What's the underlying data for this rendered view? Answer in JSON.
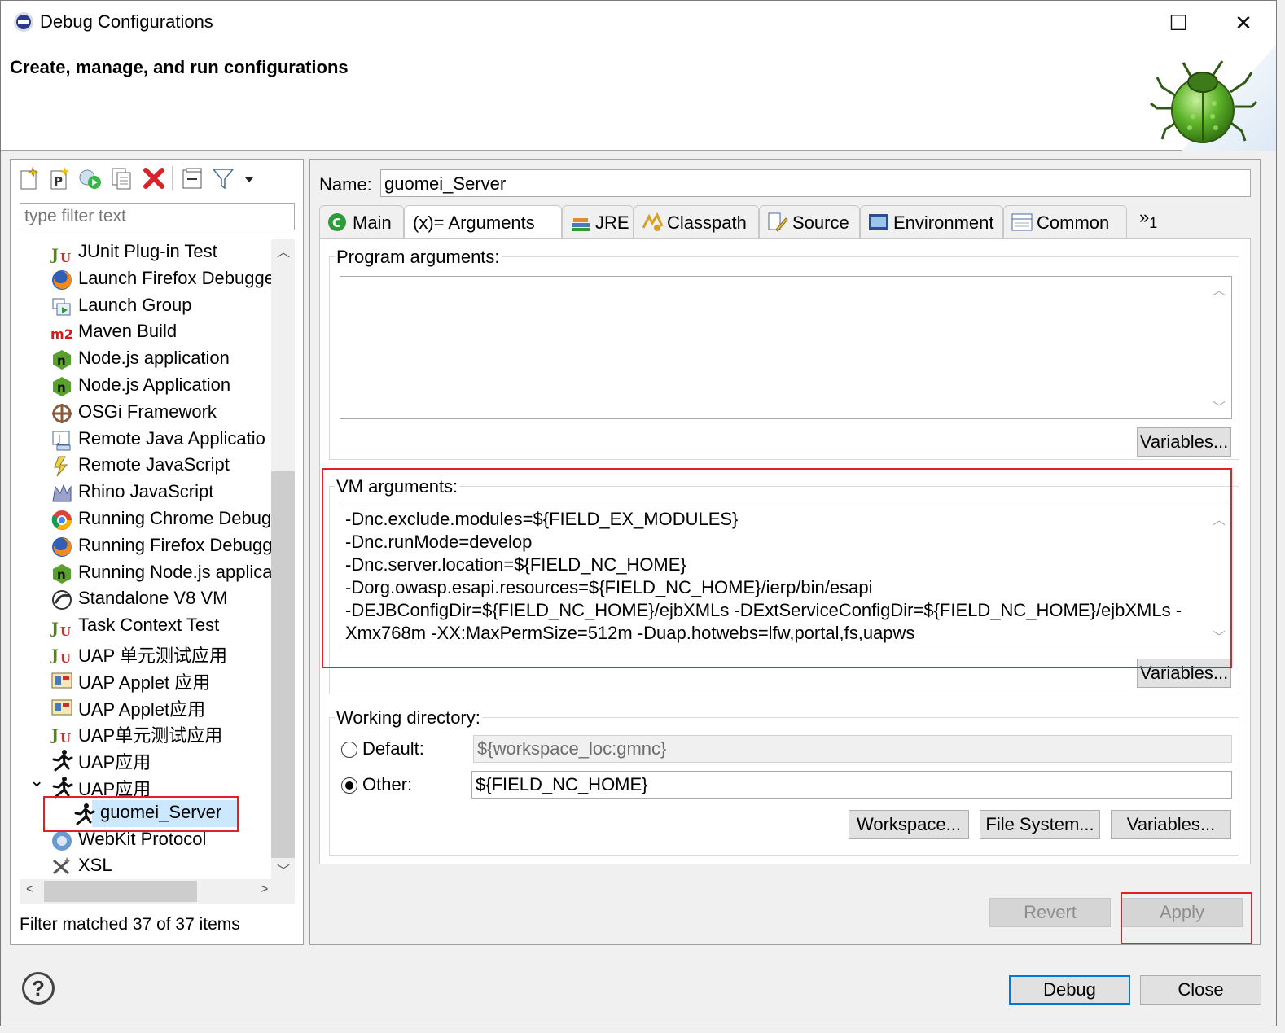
{
  "window": {
    "title": "Debug Configurations",
    "banner_title": "Create, manage, and run configurations",
    "maximize_glyph": "☐",
    "close_glyph": "✕"
  },
  "left": {
    "filter_placeholder": "type filter text",
    "items": [
      {
        "label": "JUnit Plug-in Test",
        "icon": "junit-plugin-icon"
      },
      {
        "label": "Launch Firefox Debugge",
        "icon": "firefox-icon"
      },
      {
        "label": "Launch Group",
        "icon": "launch-group-icon"
      },
      {
        "label": "Maven Build",
        "icon": "maven-icon"
      },
      {
        "label": "Node.js application",
        "icon": "nodejs-icon"
      },
      {
        "label": "Node.js Application",
        "icon": "nodejs-icon"
      },
      {
        "label": "OSGi Framework",
        "icon": "osgi-icon"
      },
      {
        "label": "Remote Java Applicatio",
        "icon": "remote-java-icon"
      },
      {
        "label": "Remote JavaScript",
        "icon": "remote-javascript-icon"
      },
      {
        "label": "Rhino JavaScript",
        "icon": "rhino-icon"
      },
      {
        "label": "Running Chrome Debug",
        "icon": "chrome-icon"
      },
      {
        "label": "Running Firefox Debugg",
        "icon": "firefox-icon"
      },
      {
        "label": "Running Node.js applica",
        "icon": "nodejs-icon"
      },
      {
        "label": "Standalone V8 VM",
        "icon": "v8-icon"
      },
      {
        "label": "Task Context Test",
        "icon": "task-context-icon"
      },
      {
        "label": "UAP 单元测试应用",
        "icon": "junit-icon"
      },
      {
        "label": "UAP Applet 应用",
        "icon": "applet-icon"
      },
      {
        "label": "UAP Applet应用",
        "icon": "applet-icon"
      },
      {
        "label": "UAP单元测试应用",
        "icon": "junit-icon"
      },
      {
        "label": "UAP应用",
        "icon": "runner-icon"
      },
      {
        "label": "UAP应用",
        "icon": "runner-icon",
        "expanded": true
      },
      {
        "label": "guomei_Server",
        "icon": "runner-icon",
        "child": true,
        "selected": true
      },
      {
        "label": "WebKit Protocol",
        "icon": "webkit-icon"
      },
      {
        "label": "XSL",
        "icon": "xsl-icon"
      }
    ],
    "status": "Filter matched 37 of 37 items",
    "expander_glyph": "⌄",
    "scroll_up": "︿",
    "scroll_down": "﹀",
    "scroll_left": "<",
    "scroll_right": ">"
  },
  "right": {
    "name_label": "Name:",
    "name_value": "guomei_Server",
    "tabs": [
      {
        "label": "Main",
        "icon": "main-tab-icon"
      },
      {
        "label": "(x)= Arguments",
        "icon": "arguments-tab-icon",
        "active": true
      },
      {
        "label": "JRE",
        "icon": "jre-tab-icon"
      },
      {
        "label": "Classpath",
        "icon": "classpath-tab-icon"
      },
      {
        "label": "Source",
        "icon": "source-tab-icon"
      },
      {
        "label": "Environment",
        "icon": "environment-tab-icon"
      },
      {
        "label": "Common",
        "icon": "common-tab-icon"
      }
    ],
    "more_tabs": "»",
    "more_tabs_count": "1",
    "program_args_label": "Program arguments:",
    "program_args_value": "",
    "variables_label": "Variables...",
    "vm_args_label": "VM arguments:",
    "vm_args_lines": [
      "-Dnc.exclude.modules=${FIELD_EX_MODULES}",
      "-Dnc.runMode=develop",
      "-Dnc.server.location=${FIELD_NC_HOME}",
      "-Dorg.owasp.esapi.resources=${FIELD_NC_HOME}/ierp/bin/esapi",
      "-DEJBConfigDir=${FIELD_NC_HOME}/ejbXMLs -DExtServiceConfigDir=${FIELD_NC_HOME}/ejbXMLs -",
      "Xmx768m -XX:MaxPermSize=512m -Duap.hotwebs=lfw,portal,fs,uapws"
    ],
    "working_dir_label": "Working directory:",
    "default_label": "Default:",
    "default_value": "${workspace_loc:gmnc}",
    "other_label": "Other:",
    "other_value": "${FIELD_NC_HOME}",
    "workspace_btn": "Workspace...",
    "filesystem_btn": "File System...",
    "variables_btn": "Variables...",
    "revert_btn": "Revert",
    "apply_btn": "Apply"
  },
  "footer": {
    "help_glyph": "?",
    "debug_btn": "Debug",
    "close_btn": "Close"
  },
  "colors": {
    "highlight_box": "#e0202a",
    "default_button_border": "#0078d7",
    "selection": "#cce8ff"
  }
}
